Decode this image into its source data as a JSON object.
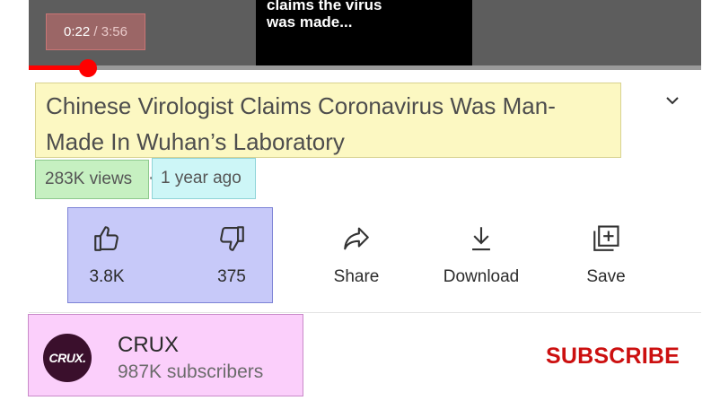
{
  "player": {
    "caption": "claims the virus\nwas made...",
    "time_current": "0:22",
    "time_separator": " / ",
    "time_duration": "3:56",
    "progress_fraction": 0.088
  },
  "video": {
    "title": "Chinese Virologist Claims Coronavirus Was Man-Made In Wuhan’s Laboratory",
    "views": "283K views",
    "age": "1 year ago"
  },
  "actions": {
    "like": {
      "label": "3.8K",
      "icon": "thumbs-up-icon"
    },
    "dislike": {
      "label": "375",
      "icon": "thumbs-down-icon"
    },
    "share": {
      "label": "Share",
      "icon": "share-icon"
    },
    "download": {
      "label": "Download",
      "icon": "download-icon"
    },
    "save": {
      "label": "Save",
      "icon": "save-to-playlist-icon"
    }
  },
  "channel": {
    "avatar_text": "CRUX.",
    "name": "CRUX",
    "subscribers": "987K subscribers",
    "subscribe_label": "SUBSCRIBE"
  },
  "colors": {
    "accent": "#cc1010",
    "progress": "#ff0000"
  }
}
